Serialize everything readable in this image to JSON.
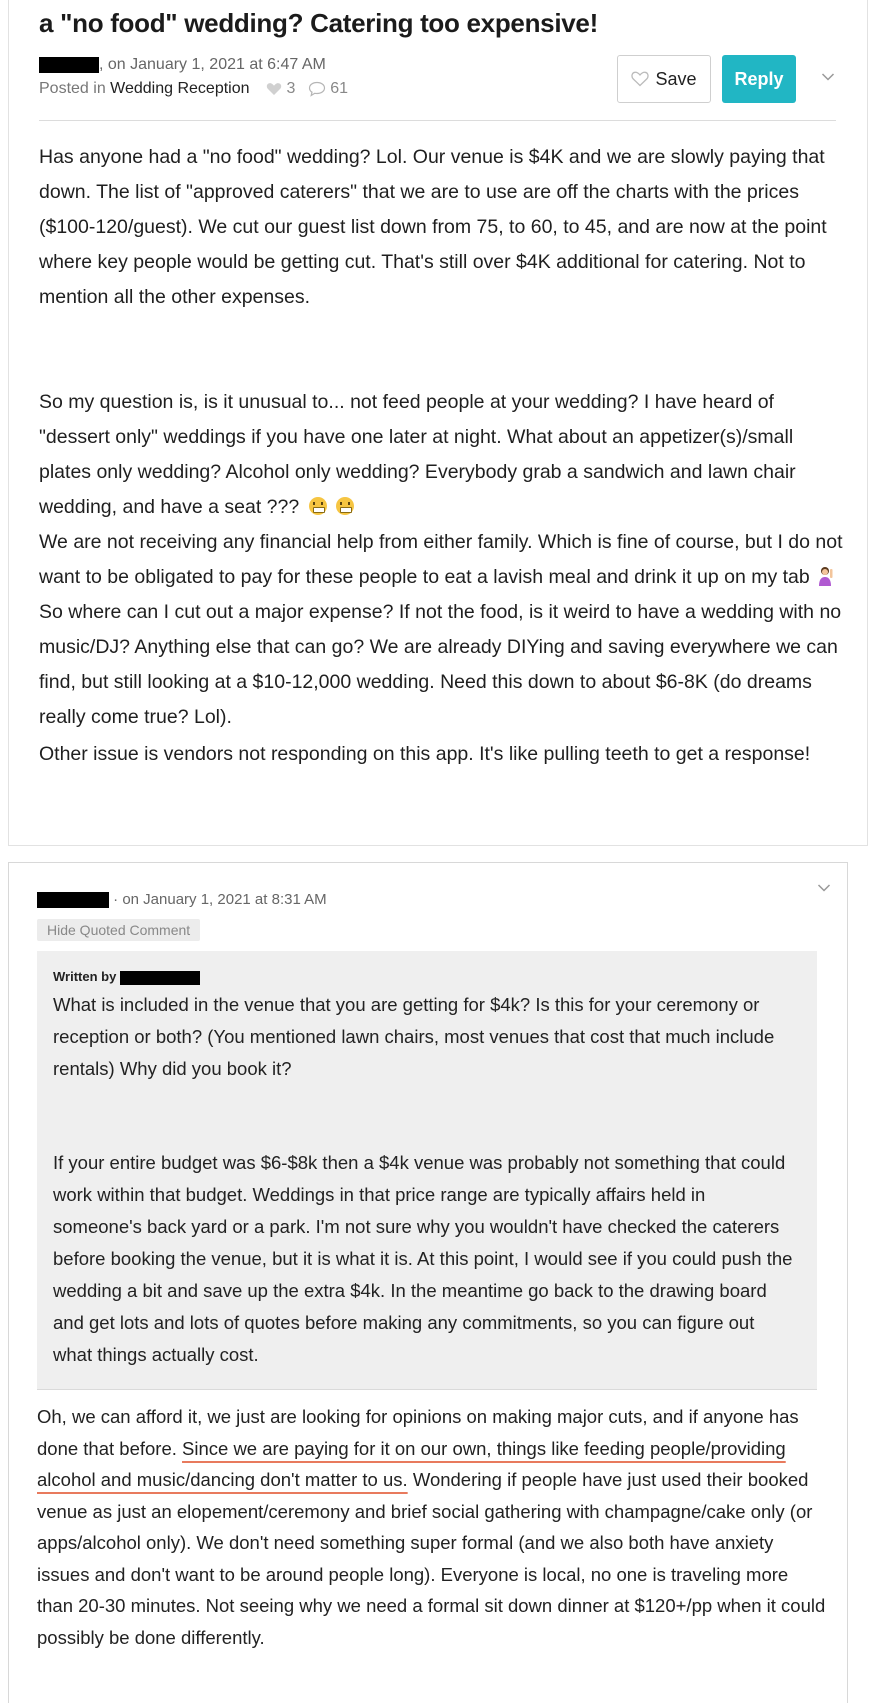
{
  "post": {
    "title": "a \"no food\" wedding? Catering too expensive!",
    "date_text": ", on January 1, 2021 at 6:47 AM",
    "posted_in_label": "Posted in",
    "category": "Wedding Reception",
    "likes": "3",
    "comments": "61",
    "save_label": "Save",
    "reply_label": "Reply",
    "p1": "Has anyone had a \"no food\" wedding? Lol. Our venue is $4K and we are slowly paying that down. The list of \"approved caterers\" that we are to use are off the charts with the prices ($100-120/guest). We cut our guest list down from 75, to 60, to 45, and are now at the point where key people would be getting cut. That's still over $4K additional for catering. Not to mention all the other expenses.",
    "p2": "So my question is, is it unusual to... not feed people at your wedding? I have heard of \"dessert only\" weddings if you have one later at night. What about an appetizer(s)/small plates only wedding? Alcohol only wedding? Everybody grab a sandwich and lawn chair wedding, and have a seat ???",
    "p3a": "We are not receiving any financial help from either family. Which is fine of course, but I do not want to be obligated to pay for these people to eat a lavish meal and drink it up on my tab",
    "p3b": "So where can I cut out a major expense? If not the food, is it weird to have a wedding with no music/DJ? Anything else that can go? We are already DIYing and saving everywhere we can find, but still looking at a $10-12,000 wedding. Need this down to about $6-8K (do dreams really come true? Lol).",
    "p4": "Other issue is vendors not responding on this app. It's like pulling teeth to get a response!"
  },
  "comment": {
    "date_text": "· on January 1, 2021 at 8:31 AM",
    "hide_quote_label": "Hide Quoted Comment",
    "written_by_label": "Written by",
    "quote_p1": "What is included in the venue that you are getting for $4k? Is this for your ceremony or reception or both? (You mentioned lawn chairs, most venues that cost that much include rentals) Why did you book it?",
    "quote_p2": "If your entire budget was $6-$8k then a $4k venue was probably not something that could work within that budget. Weddings in that price range are typically affairs held in someone's back yard or a park. I'm not sure why you wouldn't have checked the caterers before booking the venue, but it is what it is. At this point, I would see if you could push the wedding a bit and save up the extra $4k. In the meantime go back to the drawing board and get lots and lots of quotes before making any commitments, so you can figure out what things actually cost.",
    "reply_a": "Oh, we can afford it, we just are looking for opinions on making major cuts, and if anyone has done that before.",
    "reply_underlined": "Since we are paying for it on our own, things like feeding people/providing alcohol and music/dancing don't matter to us.",
    "reply_b": "Wondering if people have just used their booked venue as just an elopement/ceremony and brief social gathering with champagne/cake only (or apps/alcohol only). We don't need something super formal (and we also both have anxiety issues and don't want to be around people long). Everyone is local, no one is traveling more than 20-30 minutes. Not seeing why we need a formal sit down dinner at $120+/pp when it could possibly be done differently."
  },
  "colors": {
    "reply_button": "#21b6c4",
    "underline": "#e87a5d",
    "quote_bg": "#efefef"
  },
  "icons": [
    "heart-icon",
    "comment-bubble-icon",
    "chevron-down-icon",
    "grimace-emoji",
    "person-gesture-emoji"
  ]
}
